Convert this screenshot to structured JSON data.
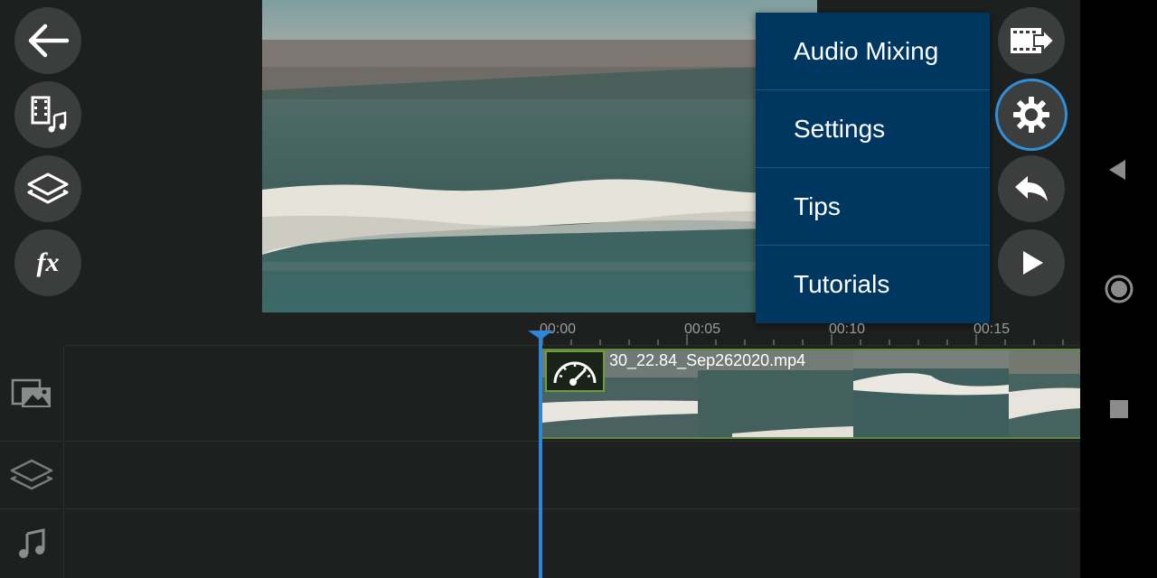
{
  "toolbar_left": {
    "back_icon": "arrow-left-icon",
    "media_icon": "film-music-icon",
    "layer_icon": "layers-icon",
    "fx_label": "fx"
  },
  "toolbar_right": {
    "export_icon": "film-export-icon",
    "settings_icon": "gear-icon",
    "undo_icon": "undo-icon",
    "play_icon": "play-icon"
  },
  "menu": {
    "items": [
      {
        "label": "Audio Mixing"
      },
      {
        "label": "Settings"
      },
      {
        "label": "Tips"
      },
      {
        "label": "Tutorials"
      }
    ]
  },
  "timeline": {
    "ticks": [
      "00:00",
      "00:05",
      "00:10",
      "00:15"
    ],
    "clip_name": "30_22.84_Sep262020.mp4",
    "tracks": [
      "video-track",
      "overlay-track",
      "audio-track"
    ]
  },
  "colors": {
    "menu_bg": "#003761",
    "accent": "#2e86d9",
    "clip_border": "#5c8a3a"
  }
}
